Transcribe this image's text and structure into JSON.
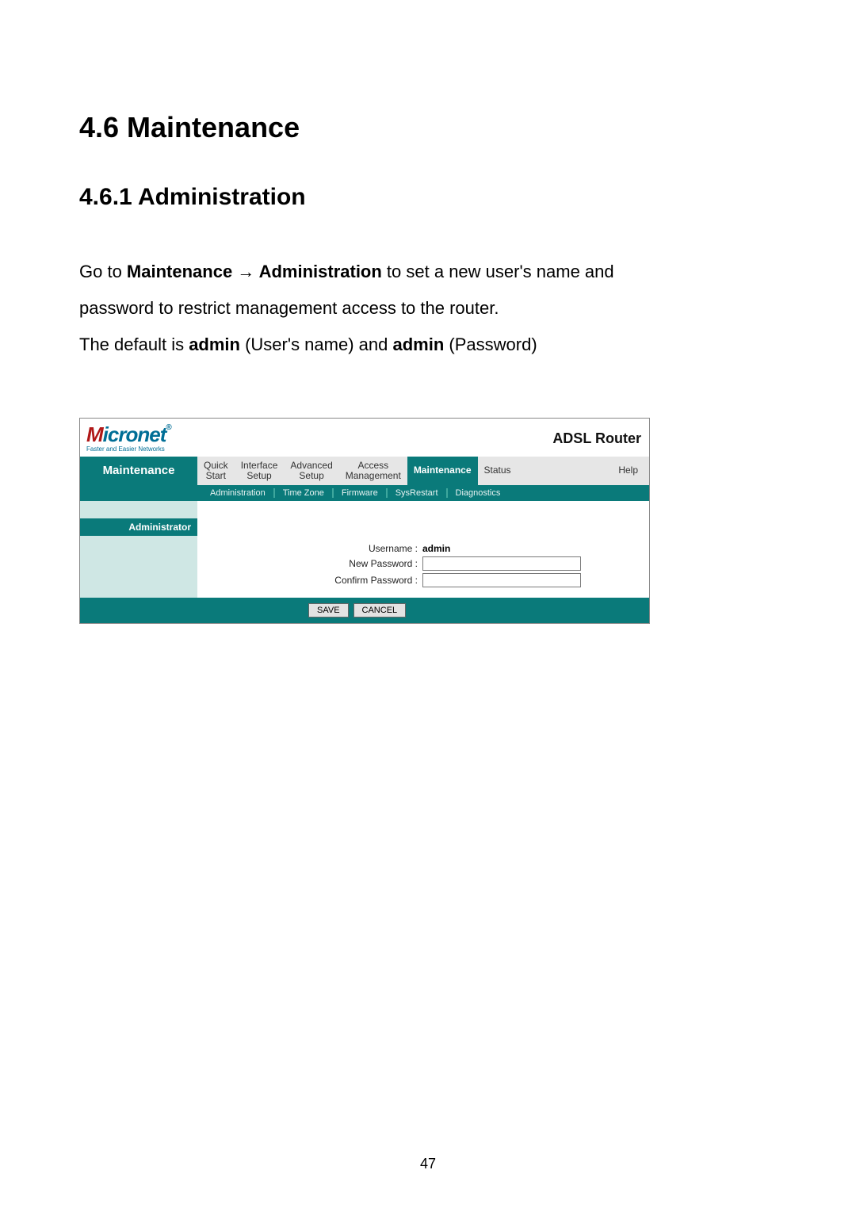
{
  "doc": {
    "heading1": "4.6 Maintenance",
    "heading2": "4.6.1 Administration",
    "para1_pre": "Go to ",
    "para1_bold": "Maintenance → Administration",
    "para1_post": " to set a new user's name and",
    "para2": "password to restrict management access to the router.",
    "para3_pre": "The default is ",
    "para3_b1": "admin",
    "para3_mid": " (User's name) and ",
    "para3_b2": "admin",
    "para3_post": " (Password)",
    "page_number": "47"
  },
  "router": {
    "logo_text": "Micronet",
    "logo_sub": "Faster and Easier Networks",
    "product": "ADSL Router",
    "left_title": "Maintenance",
    "main_tabs": [
      {
        "l1": "Quick",
        "l2": "Start"
      },
      {
        "l1": "Interface",
        "l2": "Setup"
      },
      {
        "l1": "Advanced",
        "l2": "Setup"
      },
      {
        "l1": "Access",
        "l2": "Management"
      },
      {
        "l1": "Maintenance",
        "l2": ""
      },
      {
        "l1": "Status",
        "l2": ""
      },
      {
        "l1": "Help",
        "l2": ""
      }
    ],
    "active_tab_index": 4,
    "sub_tabs": [
      "Administration",
      "Time Zone",
      "Firmware",
      "SysRestart",
      "Diagnostics"
    ],
    "section_title": "Administrator",
    "form": {
      "username_label": "Username :",
      "username_value": "admin",
      "newpass_label": "New Password :",
      "confirmpass_label": "Confirm Password :"
    },
    "buttons": {
      "save": "SAVE",
      "cancel": "CANCEL"
    }
  }
}
